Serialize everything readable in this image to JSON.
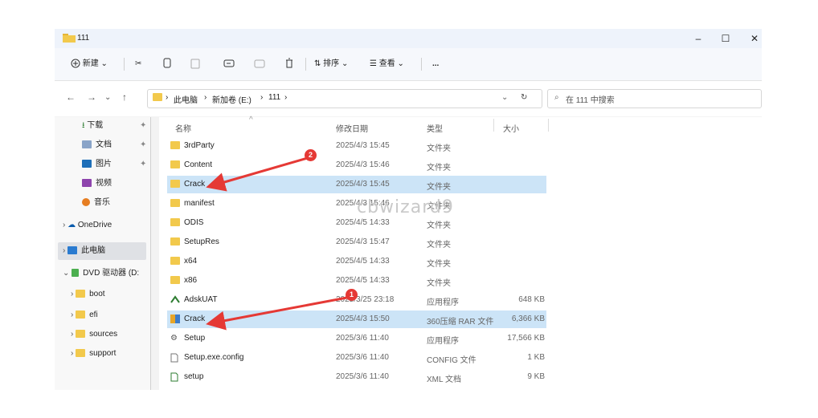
{
  "window": {
    "title": "111"
  },
  "toolbar": {
    "new_label": "新建",
    "sort_label": "排序",
    "view_label": "查看",
    "more_label": "..."
  },
  "address": {
    "crumb1": "此电脑",
    "crumb2": "新加卷 (E:)",
    "crumb3": "111",
    "search_placeholder": "在 111 中搜索"
  },
  "nav": {
    "items": [
      {
        "label": "下载"
      },
      {
        "label": "文档"
      },
      {
        "label": "图片"
      },
      {
        "label": "视频"
      },
      {
        "label": "音乐"
      },
      {
        "label": "OneDrive"
      },
      {
        "label": "此电脑"
      },
      {
        "label": "DVD 驱动器 (D:"
      },
      {
        "label": "boot"
      },
      {
        "label": "efi"
      },
      {
        "label": "sources"
      },
      {
        "label": "support"
      }
    ]
  },
  "columns": {
    "name": "名称",
    "date": "修改日期",
    "type": "类型",
    "size": "大小"
  },
  "files": [
    {
      "name": "3rdParty",
      "date": "2025/4/3 15:45",
      "type": "文件夹",
      "size": ""
    },
    {
      "name": "Content",
      "date": "2025/4/3 15:46",
      "type": "文件夹",
      "size": ""
    },
    {
      "name": "Crack",
      "date": "2025/4/3 15:45",
      "type": "文件夹",
      "size": ""
    },
    {
      "name": "manifest",
      "date": "2025/4/3 15:46",
      "type": "文件夹",
      "size": ""
    },
    {
      "name": "ODIS",
      "date": "2025/4/5 14:33",
      "type": "文件夹",
      "size": ""
    },
    {
      "name": "SetupRes",
      "date": "2025/4/3 15:47",
      "type": "文件夹",
      "size": ""
    },
    {
      "name": "x64",
      "date": "2025/4/5 14:33",
      "type": "文件夹",
      "size": ""
    },
    {
      "name": "x86",
      "date": "2025/4/5 14:33",
      "type": "文件夹",
      "size": ""
    },
    {
      "name": "AdskUAT",
      "date": "2025/3/25 23:18",
      "type": "应用程序",
      "size": "648 KB"
    },
    {
      "name": "Crack",
      "date": "2025/4/3 15:50",
      "type": "360压缩 RAR 文件",
      "size": "6,366 KB"
    },
    {
      "name": "Setup",
      "date": "2025/3/6 11:40",
      "type": "应用程序",
      "size": "17,566 KB"
    },
    {
      "name": "Setup.exe.config",
      "date": "2025/3/6 11:40",
      "type": "CONFIG 文件",
      "size": "1 KB"
    },
    {
      "name": "setup",
      "date": "2025/3/6 11:40",
      "type": "XML 文档",
      "size": "9 KB"
    }
  ],
  "annotations": {
    "badge1": "1",
    "badge2": "2",
    "watermark": "cbwizard9"
  },
  "colors": {
    "selection": "#cce4f7",
    "folder": "#f2c94c",
    "arrow": "#e53935"
  }
}
